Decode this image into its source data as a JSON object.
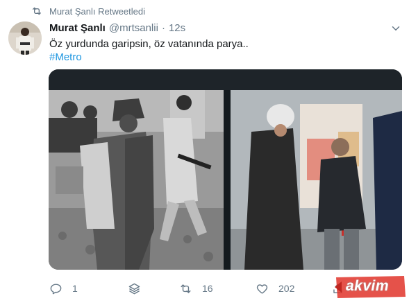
{
  "retweet": {
    "label": "Murat Şanlı Retweetledi",
    "icon": "retweet-icon"
  },
  "tweet": {
    "author_name": "Murat Şanlı",
    "author_handle": "@mrtsanlii",
    "separator": "·",
    "timestamp": "12s",
    "text": "Öz yurdunda garipsin, öz vatanında parya..",
    "hashtag": "#Metro"
  },
  "actions": {
    "reply_count": "1",
    "retweet_count": "16",
    "like_count": "202"
  },
  "watermark": {
    "text": "akvim"
  },
  "colors": {
    "accent": "#1b95e0",
    "secondary_text": "#657786",
    "watermark": "#e0342a"
  }
}
